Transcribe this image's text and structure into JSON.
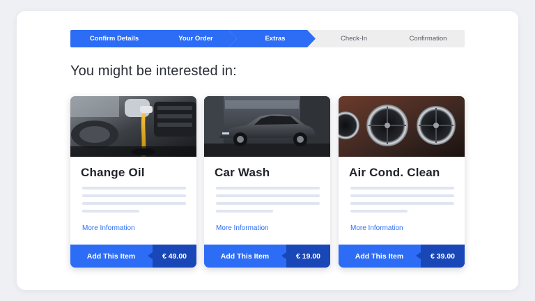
{
  "stepper": {
    "steps": [
      {
        "label": "Confirm Details",
        "state": "active"
      },
      {
        "label": "Your Order",
        "state": "active"
      },
      {
        "label": "Extras",
        "state": "active"
      },
      {
        "label": "Check-In",
        "state": "inactive"
      },
      {
        "label": "Confirmation",
        "state": "inactive"
      }
    ]
  },
  "heading": "You might be interested in:",
  "cards": [
    {
      "title": "Change Oil",
      "image": "engine-oil-pour-photo",
      "more": "More Information",
      "cta": "Add This Item",
      "price": "€ 49.00"
    },
    {
      "title": "Car Wash",
      "image": "car-in-wash-bay-photo",
      "more": "More Information",
      "cta": "Add This Item",
      "price": "€ 19.00"
    },
    {
      "title": "Air Cond. Clean",
      "image": "air-vent-photo",
      "more": "More Information",
      "cta": "Add This Item",
      "price": "€ 39.00"
    }
  ],
  "colors": {
    "accent": "#2d6df5",
    "accent_dark": "#1a47b8",
    "inactive_step": "#eeeeee",
    "text_line": "#dfe5f1"
  }
}
